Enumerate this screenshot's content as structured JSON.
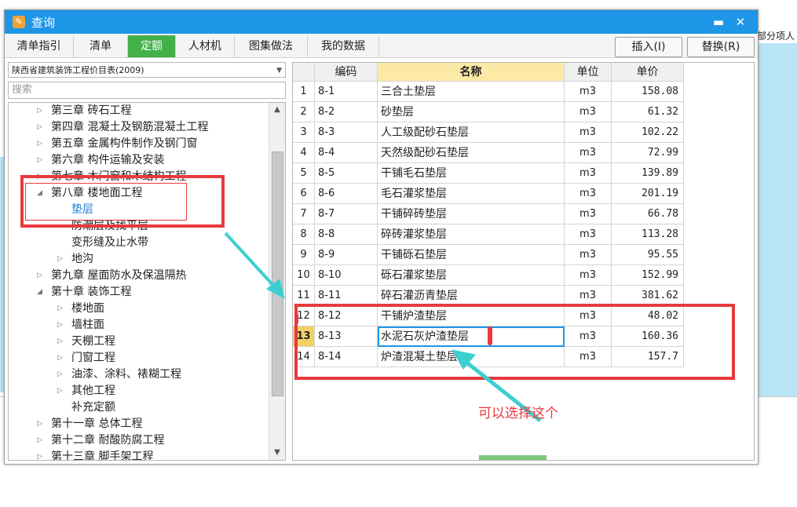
{
  "background": {
    "right_header_text": "部分项人",
    "colors": {
      "light_blue": "#b8e4f5"
    }
  },
  "dialog": {
    "title": "查询",
    "title_icon": "app-logo-icon",
    "minimize_glyph": "▬",
    "close_glyph": "✕",
    "colors": {
      "titlebar": "#1e96e8",
      "active_tab": "#43b048",
      "current_row": "#f3d066",
      "annotation": "#e8393c",
      "arrow": "#3ccfd0"
    }
  },
  "tabs": [
    {
      "label": "清单指引",
      "active": false
    },
    {
      "label": "清单",
      "active": false
    },
    {
      "label": "定额",
      "active": true
    },
    {
      "label": "人材机",
      "active": false
    },
    {
      "label": "图集做法",
      "active": false
    },
    {
      "label": "我的数据",
      "active": false
    }
  ],
  "toolbar": {
    "insert_label": "插入(I)",
    "replace_label": "替换(R)"
  },
  "left": {
    "library": "陕西省建筑装饰工程价目表(2009)",
    "search_placeholder": "搜索",
    "tree": [
      {
        "label": "第三章 砖石工程",
        "level": 0,
        "expander": "▷",
        "selected": false
      },
      {
        "label": "第四章 混凝土及钢筋混凝土工程",
        "level": 0,
        "expander": "▷",
        "selected": false
      },
      {
        "label": "第五章 金属构件制作及钢门窗",
        "level": 0,
        "expander": "▷",
        "selected": false
      },
      {
        "label": "第六章 构件运输及安装",
        "level": 0,
        "expander": "▷",
        "selected": false
      },
      {
        "label": "第七章 木门窗和木结构工程",
        "level": 0,
        "expander": "▷",
        "selected": false
      },
      {
        "label": "第八章 楼地面工程",
        "level": 0,
        "expander": "◢",
        "selected": false
      },
      {
        "label": "垫层",
        "level": 1,
        "expander": "",
        "selected": true
      },
      {
        "label": "防潮层及找平层",
        "level": 1,
        "expander": "",
        "selected": false
      },
      {
        "label": "变形缝及止水带",
        "level": 1,
        "expander": "",
        "selected": false
      },
      {
        "label": "地沟",
        "level": 1,
        "expander": "▷",
        "selected": false
      },
      {
        "label": "第九章 屋面防水及保温隔热",
        "level": 0,
        "expander": "▷",
        "selected": false
      },
      {
        "label": "第十章 装饰工程",
        "level": 0,
        "expander": "◢",
        "selected": false
      },
      {
        "label": "楼地面",
        "level": 1,
        "expander": "▷",
        "selected": false
      },
      {
        "label": "墙柱面",
        "level": 1,
        "expander": "▷",
        "selected": false
      },
      {
        "label": "天棚工程",
        "level": 1,
        "expander": "▷",
        "selected": false
      },
      {
        "label": "门窗工程",
        "level": 1,
        "expander": "▷",
        "selected": false
      },
      {
        "label": "油漆、涂料、裱糊工程",
        "level": 1,
        "expander": "▷",
        "selected": false
      },
      {
        "label": "其他工程",
        "level": 1,
        "expander": "▷",
        "selected": false
      },
      {
        "label": "补充定额",
        "level": 1,
        "expander": "",
        "selected": false
      },
      {
        "label": "第十一章 总体工程",
        "level": 0,
        "expander": "▷",
        "selected": false
      },
      {
        "label": "第十二章 耐酸防腐工程",
        "level": 0,
        "expander": "▷",
        "selected": false
      },
      {
        "label": "第十三章 脚手架工程",
        "level": 0,
        "expander": "▷",
        "selected": false
      }
    ]
  },
  "table": {
    "headers": {
      "code": "编码",
      "name": "名称",
      "unit": "单位",
      "price": "单价"
    },
    "rows": [
      {
        "no": "1",
        "code": "8-1",
        "name": "三合土垫层",
        "unit": "m3",
        "price": "158.08"
      },
      {
        "no": "2",
        "code": "8-2",
        "name": "砂垫层",
        "unit": "m3",
        "price": "61.32"
      },
      {
        "no": "3",
        "code": "8-3",
        "name": "人工级配砂石垫层",
        "unit": "m3",
        "price": "102.22"
      },
      {
        "no": "4",
        "code": "8-4",
        "name": "天然级配砂石垫层",
        "unit": "m3",
        "price": "72.99"
      },
      {
        "no": "5",
        "code": "8-5",
        "name": "干铺毛石垫层",
        "unit": "m3",
        "price": "139.89"
      },
      {
        "no": "6",
        "code": "8-6",
        "name": "毛石灌浆垫层",
        "unit": "m3",
        "price": "201.19"
      },
      {
        "no": "7",
        "code": "8-7",
        "name": "干铺碎砖垫层",
        "unit": "m3",
        "price": "66.78"
      },
      {
        "no": "8",
        "code": "8-8",
        "name": "碎砖灌浆垫层",
        "unit": "m3",
        "price": "113.28"
      },
      {
        "no": "9",
        "code": "8-9",
        "name": "干铺砾石垫层",
        "unit": "m3",
        "price": "95.55"
      },
      {
        "no": "10",
        "code": "8-10",
        "name": "砾石灌浆垫层",
        "unit": "m3",
        "price": "152.99"
      },
      {
        "no": "11",
        "code": "8-11",
        "name": "碎石灌沥青垫层",
        "unit": "m3",
        "price": "381.62"
      },
      {
        "no": "12",
        "code": "8-12",
        "name": "干铺炉渣垫层",
        "unit": "m3",
        "price": "48.02"
      },
      {
        "no": "13",
        "code": "8-13",
        "name": "水泥石灰炉渣垫层",
        "unit": "m3",
        "price": "160.36"
      },
      {
        "no": "14",
        "code": "8-14",
        "name": "炉渣混凝土垫层",
        "unit": "m3",
        "price": "157.7"
      }
    ],
    "current_row": 13
  },
  "annotation": {
    "note": "可以选择这个"
  }
}
